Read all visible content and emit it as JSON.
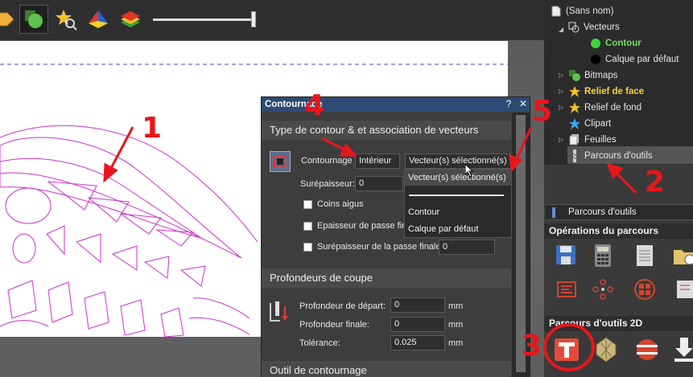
{
  "colors": {
    "annotation_red": "#e8161b",
    "dialog_title_bar": "#2d4a73",
    "highlight_green": "#6de05f",
    "highlight_yellow": "#f5d33a",
    "vector_magenta": "#cc33cc"
  },
  "toolbar": {
    "icons": [
      "orange-arrow-icon",
      "vectors-view-icon",
      "star-zoom-icon",
      "pyramid-icon",
      "layers-rainbow-icon"
    ],
    "slider_level_percent": 97
  },
  "dialog": {
    "title": "Contournage",
    "help_label": "?",
    "close_label": "✕",
    "section1": {
      "title": "Type de contour & et association de vecteurs",
      "contour_label": "Contournage",
      "contour_value": "Intérieur",
      "vector_select_value": "Vecteur(s) sélectionné(s)",
      "overthickness_label": "Surépaisseur:",
      "overthickness_value": "0",
      "sharp_corners_label": "Coins aigus",
      "finish_pass_thickness_label": "Epaisseur de passe finale",
      "finish_pass_overthickness_label": "Surépaisseur de la passe finale",
      "finish_pass_overthickness_value": "0"
    },
    "section2": {
      "title": "Profondeurs de coupe",
      "start_depth_label": "Profondeur de départ:",
      "start_depth_value": "0",
      "end_depth_label": "Profondeur finale:",
      "end_depth_value": "0",
      "tolerance_label": "Tolérance:",
      "tolerance_value": "0.025",
      "unit": "mm"
    },
    "section3": {
      "title": "Outil de contournage"
    }
  },
  "dropdown": {
    "options": [
      "Vecteur(s) sélectionné(s)",
      "Contour",
      "Calque par défaut"
    ]
  },
  "tree": {
    "root": "(Sans nom)",
    "vectors": "Vecteurs",
    "contour": "Contour",
    "default_layer": "Calque par défaut",
    "bitmaps": "Bitmaps",
    "front_relief": "Relief de face",
    "back_relief": "Relief de fond",
    "clipart": "Clipart",
    "sheets": "Feuilles",
    "toolpaths": "Parcours d'outils"
  },
  "ops_panel": {
    "tab_label": "Parcours d'outils",
    "operations_title": "Opérations du parcours",
    "toolpaths2d_title": "Parcours d'outils 2D"
  },
  "annotations": [
    "1",
    "2",
    "3",
    "4",
    "5"
  ]
}
